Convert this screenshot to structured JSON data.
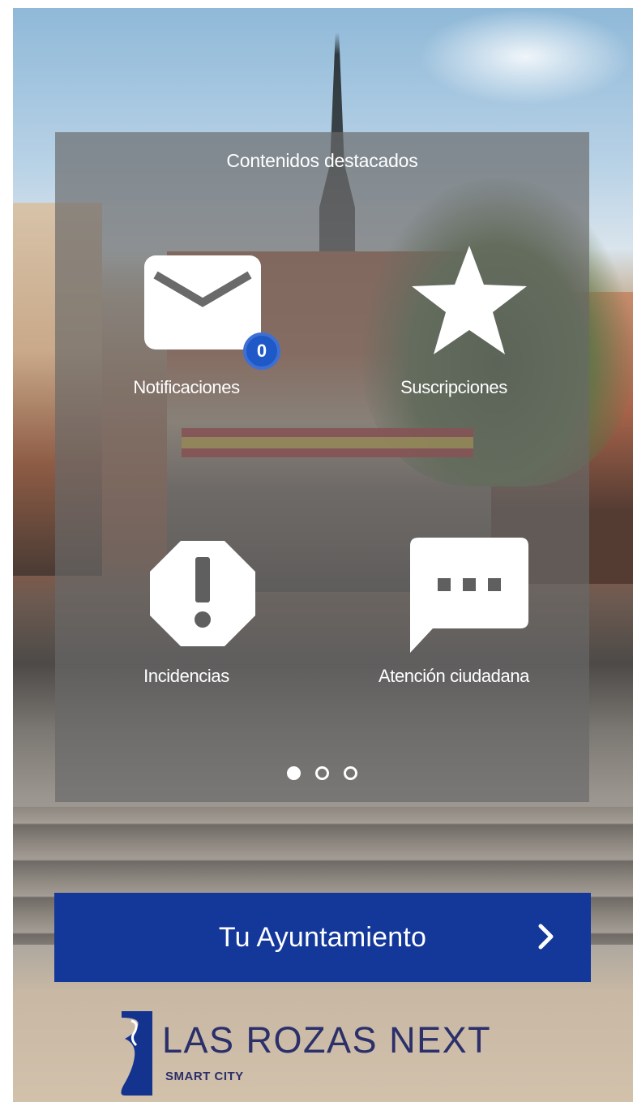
{
  "panel": {
    "title": "Contenidos destacados",
    "tiles": [
      {
        "label": "Notificaciones",
        "icon": "envelope-icon",
        "badge": "0"
      },
      {
        "label": "Suscripciones",
        "icon": "star-icon"
      },
      {
        "label": "Incidencias",
        "icon": "warning-octagon-icon"
      },
      {
        "label": "Atención ciudadana",
        "icon": "chat-bubble-icon"
      }
    ],
    "pagination": {
      "total": 3,
      "active": 1
    }
  },
  "cta": {
    "label": "Tu Ayuntamiento",
    "icon": "chevron-right-icon"
  },
  "logo": {
    "name": "LAS ROZAS NEXT",
    "tagline": "SMART CITY"
  },
  "colors": {
    "cta_background": "#13389a",
    "badge": "#1f58c7",
    "logo_text": "#2b2f6a",
    "panel_overlay": "rgba(105,105,105,0.68)"
  }
}
